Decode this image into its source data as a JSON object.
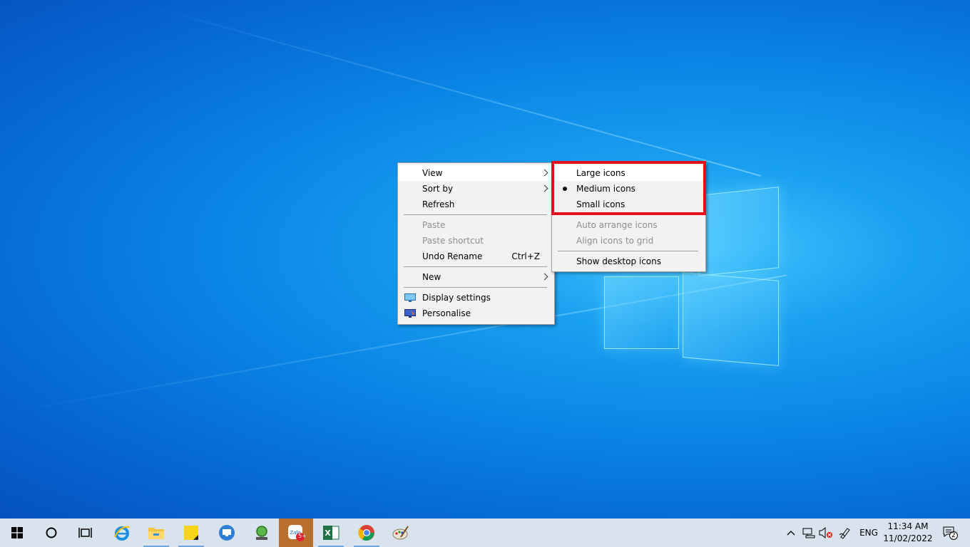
{
  "main_menu": {
    "items": [
      {
        "label": "View",
        "state": "highlighted",
        "submenu": true
      },
      {
        "label": "Sort by",
        "submenu": true
      },
      {
        "label": "Refresh"
      },
      {
        "label": "Paste",
        "disabled": true
      },
      {
        "label": "Paste shortcut",
        "disabled": true
      },
      {
        "label": "Undo Rename",
        "shortcut": "Ctrl+Z"
      },
      {
        "label": "New",
        "submenu": true
      },
      {
        "label": "Display settings",
        "icon": "display-settings-icon"
      },
      {
        "label": "Personalise",
        "icon": "personalise-icon"
      }
    ]
  },
  "view_submenu": {
    "items": [
      {
        "label": "Large icons",
        "state": "highlighted"
      },
      {
        "label": "Medium icons",
        "selected": true
      },
      {
        "label": "Small icons"
      },
      {
        "label": "Auto arrange icons",
        "disabled": true
      },
      {
        "label": "Align icons to grid",
        "disabled": true
      },
      {
        "label": "Show desktop icons"
      }
    ],
    "highlight_color": "#e0101f"
  },
  "taskbar": {
    "pinned": [
      {
        "icon": "windows-start-icon"
      },
      {
        "icon": "cortana-search-icon"
      },
      {
        "icon": "task-view-icon"
      },
      {
        "icon": "internet-explorer-icon"
      },
      {
        "icon": "file-explorer-icon"
      },
      {
        "icon": "sticky-notes-icon"
      },
      {
        "icon": "remote-desktop-icon"
      },
      {
        "icon": "network-globe-app-icon"
      },
      {
        "icon": "zalo-icon",
        "badge": "5+"
      },
      {
        "icon": "excel-icon"
      },
      {
        "icon": "chrome-icon"
      },
      {
        "icon": "paint-icon"
      }
    ],
    "tray": {
      "language": "ENG",
      "time": "11:34 AM",
      "date": "11/02/2022",
      "notification_count": "2"
    },
    "active_color": "#b86f2e"
  }
}
